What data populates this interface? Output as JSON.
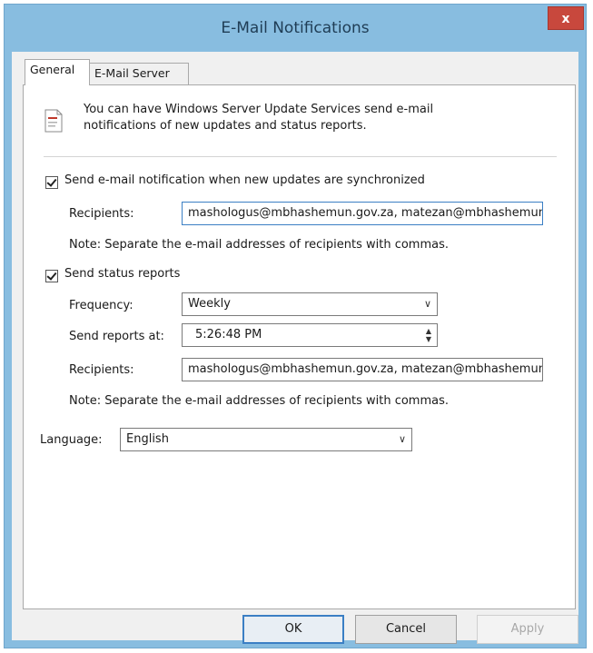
{
  "window": {
    "title": "E-Mail Notifications",
    "close_label": "x"
  },
  "tabs": [
    {
      "label": "General",
      "active": true
    },
    {
      "label": "E-Mail Server",
      "active": false
    }
  ],
  "intro_text": "You can have Windows Server Update Services send e-mail notifications of new updates and status reports.",
  "sync_notification": {
    "checkbox_label": "Send e-mail notification when new updates are synchronized",
    "checked": true,
    "recipients_label": "Recipients:",
    "recipients_value": "mashologus@mbhashemun.gov.za, matezan@mbhashemun.gov.za",
    "note": "Note: Separate the e-mail addresses of recipients with commas."
  },
  "status_reports": {
    "checkbox_label": "Send status reports",
    "checked": true,
    "frequency_label": "Frequency:",
    "frequency_value": "Weekly",
    "send_at_label": "Send reports at:",
    "send_at_value": "5:26:48 PM",
    "recipients_label": "Recipients:",
    "recipients_value": "mashologus@mbhashemun.gov.za, matezan@mbhashemun.gov.za",
    "note": "Note: Separate the e-mail addresses of recipients with commas."
  },
  "language": {
    "label": "Language:",
    "value": "English"
  },
  "buttons": {
    "ok": "OK",
    "cancel": "Cancel",
    "apply": "Apply"
  },
  "icons": {
    "info": "document-info-icon",
    "dropdown": "chevron-down-icon",
    "spinner": "spinner-arrows-icon",
    "close": "close-icon"
  },
  "colors": {
    "title_bar": "#88bde0",
    "close_button": "#c8483d",
    "focus_border": "#3b7fc4"
  }
}
